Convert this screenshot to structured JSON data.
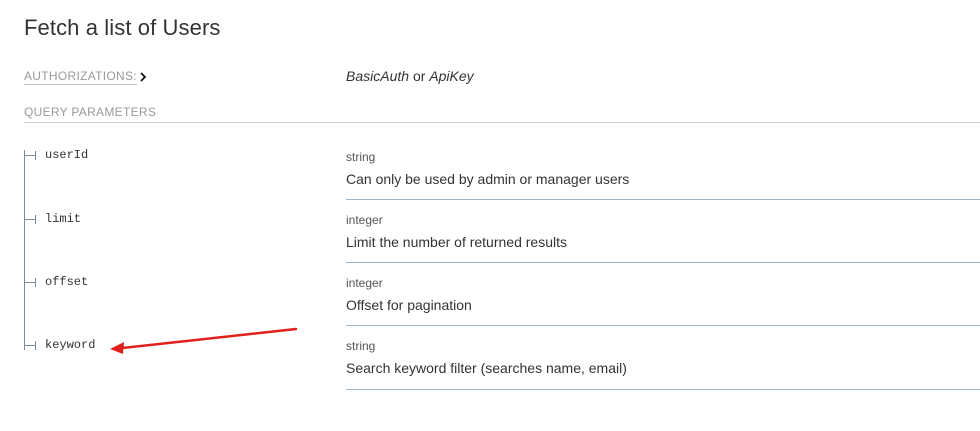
{
  "page": {
    "title": "Fetch a list of Users"
  },
  "authorizations": {
    "label": "AUTHORIZATIONS:",
    "schemes": [
      "BasicAuth",
      "ApiKey"
    ],
    "separator": "or"
  },
  "query_parameters": {
    "label": "QUERY PARAMETERS",
    "items": [
      {
        "name": "userId",
        "type": "string",
        "description": "Can only be used by admin or manager users"
      },
      {
        "name": "limit",
        "type": "integer",
        "description": "Limit the number of returned results"
      },
      {
        "name": "offset",
        "type": "integer",
        "description": "Offset for pagination"
      },
      {
        "name": "keyword",
        "type": "string",
        "description": "Search keyword filter (searches name, email)"
      }
    ]
  },
  "annotation": {
    "arrow_color": "#e0201b"
  }
}
